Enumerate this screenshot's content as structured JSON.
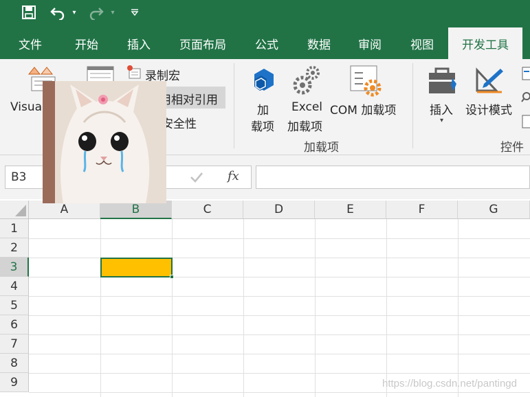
{
  "qat": {
    "save_icon": "save-icon",
    "undo_icon": "undo-icon",
    "redo_icon": "redo-icon",
    "customize_icon": "customize-icon"
  },
  "tabs": [
    {
      "label": "文件"
    },
    {
      "label": "开始"
    },
    {
      "label": "插入"
    },
    {
      "label": "页面布局"
    },
    {
      "label": "公式"
    },
    {
      "label": "数据"
    },
    {
      "label": "审阅"
    },
    {
      "label": "视图"
    },
    {
      "label": "开发工具",
      "active": true
    }
  ],
  "ribbon": {
    "code": {
      "visual_basic": "Visua",
      "record_macro": "录制宏",
      "relative_ref": "用相对引用",
      "macro_security": "安全性"
    },
    "addins": {
      "addin_line1": "加",
      "addin_line2": "载项",
      "excel_addin_line1": "Excel",
      "excel_addin_line2": "加载项",
      "com_addin": "COM 加载项",
      "group_label": "加载项"
    },
    "controls": {
      "insert": "插入",
      "design_mode": "设计模式",
      "group_label": "控件"
    }
  },
  "formula_bar": {
    "name_box": "B3",
    "fx": "fx",
    "formula": ""
  },
  "sheet": {
    "columns": [
      "A",
      "B",
      "C",
      "D",
      "E",
      "F",
      "G"
    ],
    "rows": [
      "1",
      "2",
      "3",
      "4",
      "5",
      "6",
      "7",
      "8",
      "9"
    ],
    "selected_cell": "B3",
    "selected_fill": "#ffc000"
  },
  "colors": {
    "accent": "#217346",
    "cell_fill": "#ffc000"
  },
  "watermark": "https://blog.csdn.net/pantingd"
}
